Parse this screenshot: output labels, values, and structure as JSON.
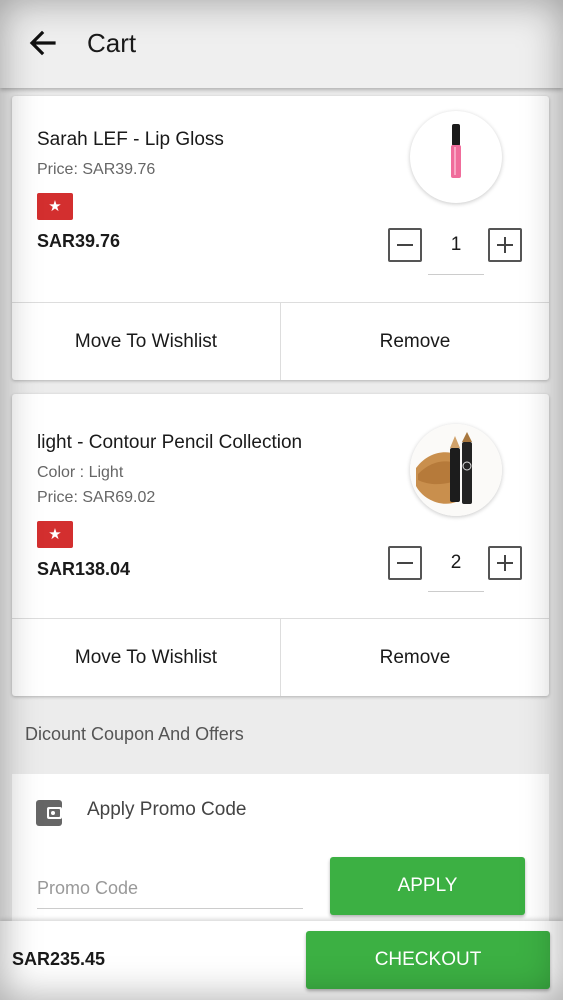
{
  "header": {
    "title": "Cart",
    "back_icon": "arrow-left-icon"
  },
  "cart_items": [
    {
      "name": "Sarah LEF - Lip Gloss",
      "price": "Price: SAR39.76",
      "badge_icon": "star-icon",
      "total": "SAR39.76",
      "quantity": "1",
      "image": "lip-gloss-product-image",
      "actions": {
        "wishlist": "Move To Wishlist",
        "remove": "Remove"
      }
    },
    {
      "name": "light - Contour Pencil Collection",
      "color": "Color : Light",
      "price": "Price: SAR69.02",
      "badge_icon": "star-icon",
      "total": "SAR138.04",
      "quantity": "2",
      "image": "contour-pencil-product-image",
      "actions": {
        "wishlist": "Move To Wishlist",
        "remove": "Remove"
      }
    }
  ],
  "offers": {
    "section_title": "Dicount Coupon And Offers",
    "promo_heading": "Apply Promo Code",
    "promo_icon": "wallet-icon",
    "promo_value": "",
    "promo_placeholder": "Promo Code",
    "apply_label": "APPLY"
  },
  "footer": {
    "total": "SAR235.45",
    "checkout_label": "CHECKOUT"
  },
  "colors": {
    "accent_green": "#3cb043",
    "badge_red": "#d32f2f"
  }
}
